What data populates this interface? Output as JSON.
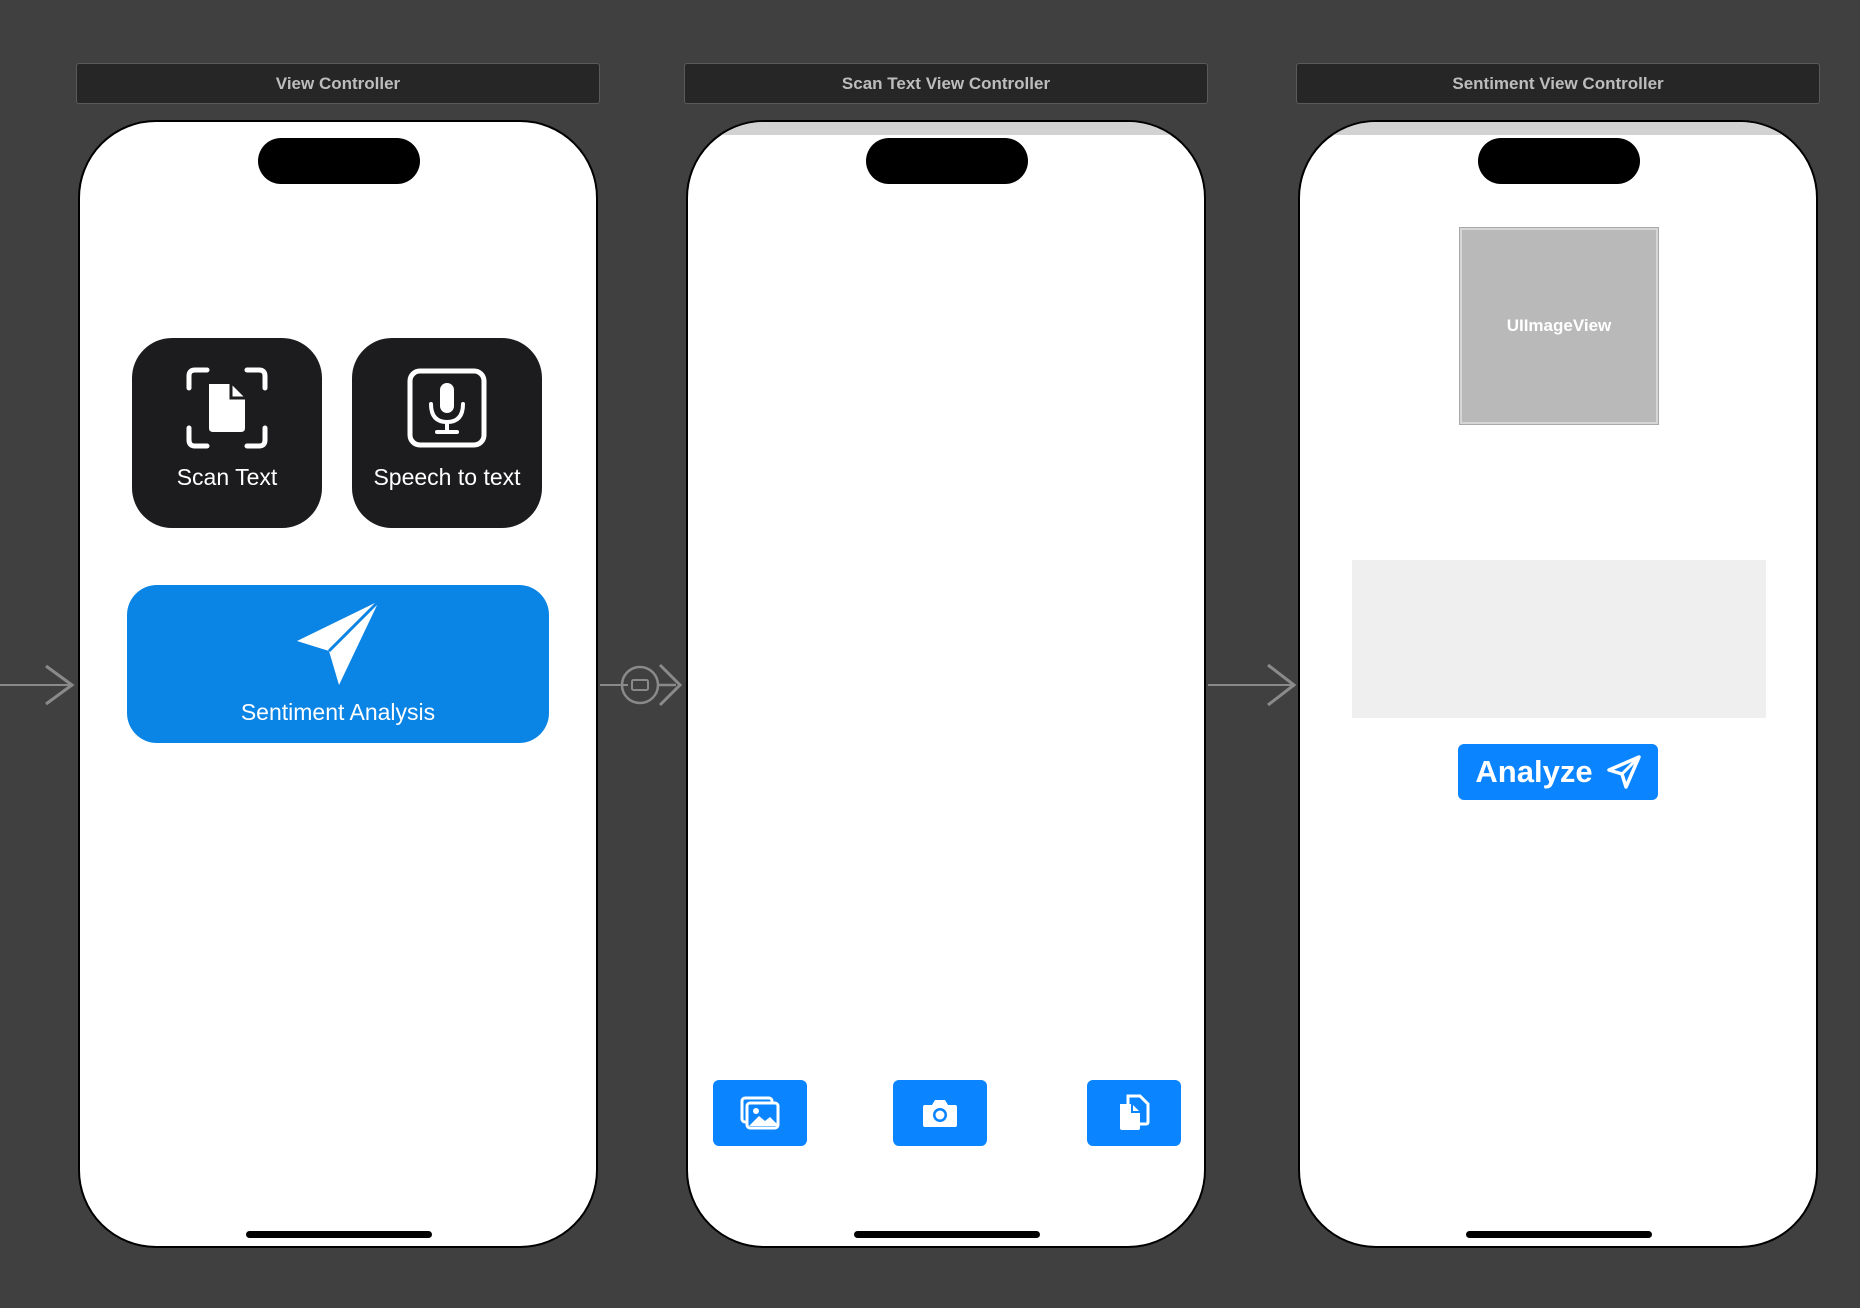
{
  "scenes": [
    {
      "title": "View Controller"
    },
    {
      "title": "Scan Text View Controller"
    },
    {
      "title": "Sentiment View Controller"
    }
  ],
  "home": {
    "scan_text_label": "Scan Text",
    "speech_label": "Speech to text",
    "sentiment_label": "Sentiment Analysis"
  },
  "scan": {
    "buttons": [
      "photo-library-icon",
      "camera-icon",
      "documents-icon"
    ]
  },
  "sentiment": {
    "image_view_label": "UIImageView",
    "analyze_label": "Analyze"
  },
  "colors": {
    "canvas": "#404040",
    "accent_blue": "#0a84ff",
    "tile_dark": "#1c1c1e"
  }
}
